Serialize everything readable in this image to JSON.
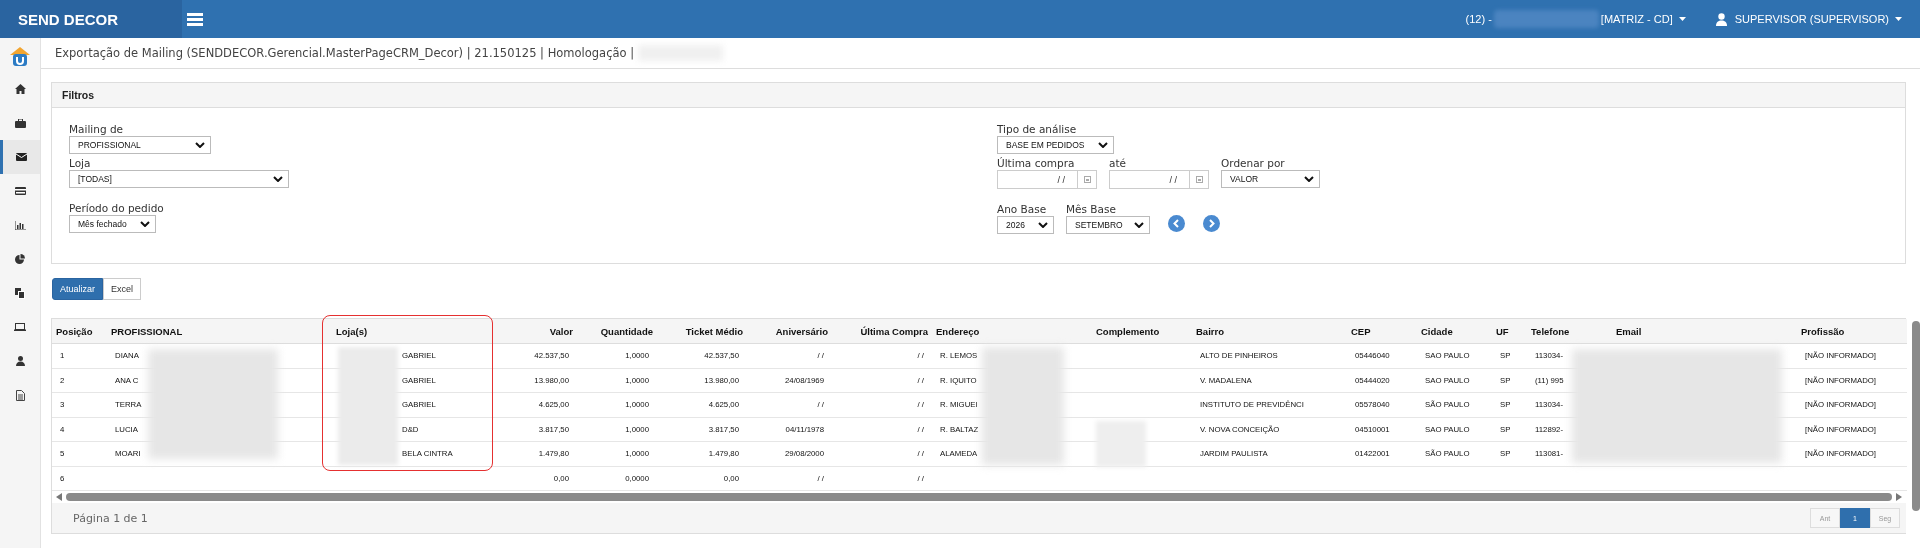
{
  "header": {
    "brand": "SEND DECOR",
    "company_prefix": "(12) -",
    "branch": "[MATRIZ - CD]",
    "user": "SUPERVISOR (SUPERVISOR)"
  },
  "sidebar": {
    "items": [
      {
        "selected": false
      },
      {
        "selected": false
      },
      {
        "selected": true
      },
      {
        "selected": false
      },
      {
        "selected": false
      },
      {
        "selected": false
      },
      {
        "selected": false
      },
      {
        "selected": false
      },
      {
        "selected": false
      },
      {
        "selected": false
      }
    ]
  },
  "breadcrumb": "Exportação de Mailing (SENDDECOR.Gerencial.MasterPageCRM_Decor) | 21.150125 | Homologação |",
  "filters": {
    "title": "Filtros",
    "mailing_de": {
      "label": "Mailing de",
      "value": "PROFISSIONAL"
    },
    "loja": {
      "label": "Loja",
      "value": "[TODAS]"
    },
    "periodo": {
      "label": "Período do pedido",
      "value": "Mês fechado"
    },
    "tipo_analise": {
      "label": "Tipo de análise",
      "value": "BASE EM PEDIDOS"
    },
    "ultima_compra": {
      "label": "Última compra",
      "value": "/ /"
    },
    "ate": {
      "label": "até",
      "value": "/ /"
    },
    "ordenar_por": {
      "label": "Ordenar por",
      "value": "VALOR"
    },
    "ano_base": {
      "label": "Ano Base",
      "value": "2026"
    },
    "mes_base": {
      "label": "Mês Base",
      "value": "SETEMBRO"
    }
  },
  "actions": [
    {
      "label": "Atualizar",
      "selected": true
    },
    {
      "label": "Excel",
      "selected": false
    }
  ],
  "table": {
    "columns": [
      {
        "label": "Posição"
      },
      {
        "label": "PROFISSIONAL"
      },
      {
        "label": "Loja(s)"
      },
      {
        "label": "Valor"
      },
      {
        "label": "Quantidade"
      },
      {
        "label": "Ticket Médio"
      },
      {
        "label": "Aniversário"
      },
      {
        "label": "Última Compra"
      },
      {
        "label": "Endereço"
      },
      {
        "label": "Complemento"
      },
      {
        "label": "Bairro"
      },
      {
        "label": "CEP"
      },
      {
        "label": "Cidade"
      },
      {
        "label": "UF"
      },
      {
        "label": "Telefone"
      },
      {
        "label": "Email"
      },
      {
        "label": "Profissão"
      }
    ],
    "rows": [
      {
        "posicao": "1",
        "profissional": "DIANA",
        "lojas": "GABRIEL",
        "valor": "42.537,50",
        "quantidade": "1,0000",
        "ticket": "42.537,50",
        "aniversario": "/ /",
        "ultima": "/ /",
        "endereco": "R. LEMOS",
        "bairro": "ALTO DE PINHEIROS",
        "cep": "05446040",
        "cidade": "SAO PAULO",
        "uf": "SP",
        "telefone": "113034-",
        "profissao": "[NÃO INFORMADO]"
      },
      {
        "posicao": "2",
        "profissional": "ANA C",
        "lojas": "GABRIEL",
        "valor": "13.980,00",
        "quantidade": "1,0000",
        "ticket": "13.980,00",
        "aniversario": "24/08/1969",
        "ultima": "/ /",
        "endereco": "R. IQUITO",
        "bairro": "V. MADALENA",
        "cep": "05444020",
        "cidade": "SAO PAULO",
        "uf": "SP",
        "telefone": "(11) 995",
        "profissao": "[NÃO INFORMADO]"
      },
      {
        "posicao": "3",
        "profissional": "TERRA",
        "lojas": "GABRIEL",
        "valor": "4.625,00",
        "quantidade": "1,0000",
        "ticket": "4.625,00",
        "aniversario": "/ /",
        "ultima": "/ /",
        "endereco": "R. MIGUEI",
        "bairro": "INSTITUTO DE PREVIDÊNCI",
        "cep": "05578040",
        "cidade": "SÃO PAULO",
        "uf": "SP",
        "telefone": "113034-",
        "profissao": "[NÃO INFORMADO]"
      },
      {
        "posicao": "4",
        "profissional": "LUCIA",
        "lojas": "D&D",
        "valor": "3.817,50",
        "quantidade": "1,0000",
        "ticket": "3.817,50",
        "aniversario": "04/11/1978",
        "ultima": "/ /",
        "endereco": "R. BALTAZ",
        "bairro": "V. NOVA CONCEIÇÃO",
        "cep": "04510001",
        "cidade": "SAO PAULO",
        "uf": "SP",
        "telefone": "112892-",
        "profissao": "[NÃO INFORMADO]"
      },
      {
        "posicao": "5",
        "profissional": "MOARI",
        "lojas": "BELA CINTRA",
        "valor": "1.479,80",
        "quantidade": "1,0000",
        "ticket": "1.479,80",
        "aniversario": "29/08/2000",
        "ultima": "/ /",
        "endereco": "ALAMEDA",
        "bairro": "JARDIM PAULISTA",
        "cep": "01422001",
        "cidade": "SÃO PAULO",
        "uf": "SP",
        "telefone": "113081-",
        "profissao": "[NÃO INFORMADO]"
      },
      {
        "posicao": "6",
        "valor": "0,00",
        "quantidade": "0,0000",
        "ticket": "0,00",
        "aniversario": "/ /",
        "ultima": "/ /"
      }
    ]
  },
  "pager": {
    "text": "Página 1 de 1",
    "buttons": [
      {
        "label": "Ant",
        "selected": false
      },
      {
        "label": "1",
        "selected": true
      },
      {
        "label": "Seg",
        "selected": false
      }
    ]
  }
}
